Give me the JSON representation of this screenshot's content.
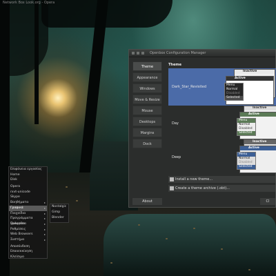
{
  "window_title": "Network Box Look.org - Opera",
  "ob_window": {
    "title": "Openbox Configuration Manager",
    "sidebar": [
      "Theme",
      "Appearance",
      "Windows",
      "Move & Resize",
      "Mouse",
      "Desktops",
      "Margins",
      "Dock"
    ],
    "about_label": "About",
    "close_label": "Cl",
    "theme_heading": "Theme",
    "themes": [
      {
        "name": "Dark_Star_Revisited",
        "selected": true
      },
      {
        "name": "Day",
        "selected": false
      },
      {
        "name": "Deep",
        "selected": false
      }
    ],
    "preview": {
      "inactive": "Inactive",
      "active": "Active",
      "menu": "Menu",
      "normal": "Normal",
      "disabled": "Disabled",
      "selected": "Selected"
    },
    "install_label": "Install a new theme...",
    "archive_label": "Create a theme archive (.obt)..."
  },
  "root_menu": {
    "items": [
      {
        "label": "Επιφάνεια εργασίας",
        "submenu": false
      },
      {
        "label": "Home",
        "submenu": false
      },
      {
        "label": "Disk",
        "submenu": false
      },
      {
        "sep": true
      },
      {
        "label": "Opera",
        "submenu": false
      },
      {
        "label": "rxvt-unicode",
        "submenu": false
      },
      {
        "label": "Skype",
        "submenu": false
      },
      {
        "label": "Βοηθήματα",
        "submenu": true
      },
      {
        "label": "Γραφικά",
        "submenu": true,
        "active": true
      },
      {
        "label": "Παιχνίδια",
        "submenu": true
      },
      {
        "label": "Προγράμματα γραφείου",
        "submenu": true
      },
      {
        "label": "Πολυμέσα",
        "submenu": true
      },
      {
        "label": "Ρυθμίσεις",
        "submenu": true
      },
      {
        "label": "Web Browsers",
        "submenu": true
      },
      {
        "label": "Συστήμα",
        "submenu": true
      },
      {
        "sep": true
      },
      {
        "label": "Αποσύνδεση",
        "submenu": false
      },
      {
        "label": "Επανεκκίνηση",
        "submenu": false
      },
      {
        "label": "Κλείσιμο",
        "submenu": false
      }
    ],
    "submenu_items": [
      "Nostalgic",
      "Gimp",
      "Blender"
    ]
  }
}
